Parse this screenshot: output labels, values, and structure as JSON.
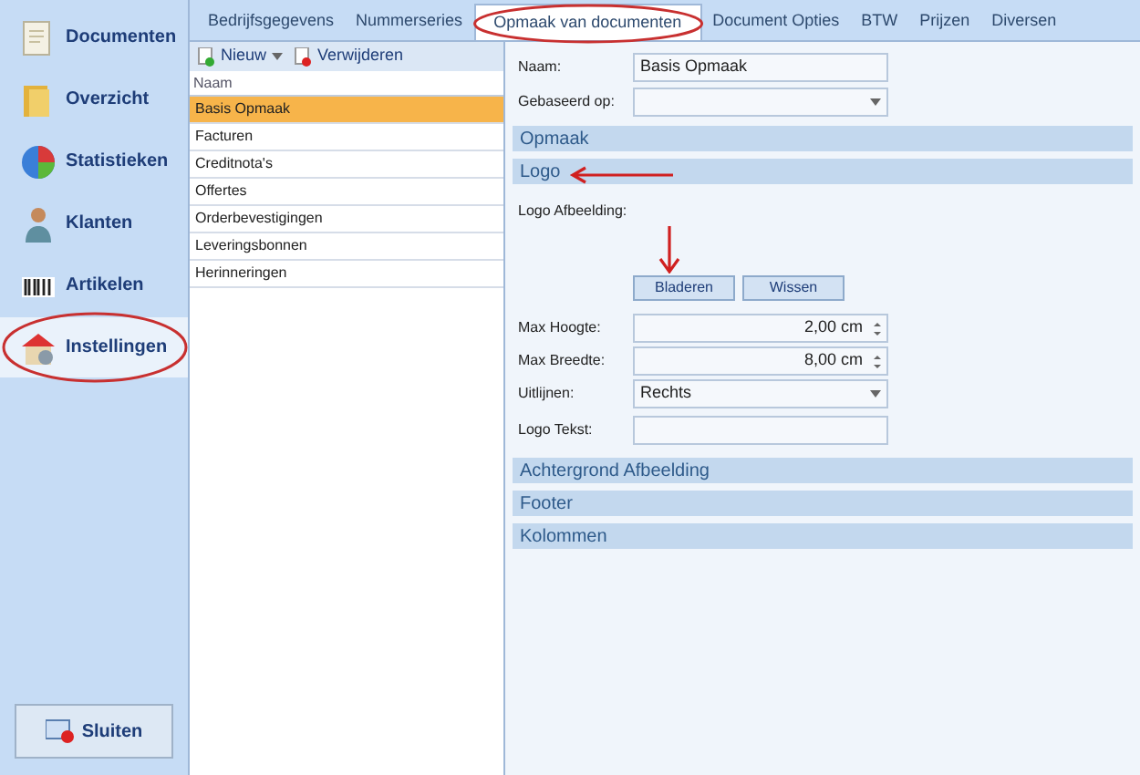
{
  "sidebar": {
    "items": [
      {
        "label": "Documenten",
        "kind": "document",
        "selected": false
      },
      {
        "label": "Overzicht",
        "kind": "folder",
        "selected": false
      },
      {
        "label": "Statistieken",
        "kind": "chart",
        "selected": false
      },
      {
        "label": "Klanten",
        "kind": "person",
        "selected": false
      },
      {
        "label": "Artikelen",
        "kind": "barcode",
        "selected": false
      },
      {
        "label": "Instellingen",
        "kind": "house",
        "selected": true
      }
    ],
    "close_button": "Sluiten"
  },
  "tabs": [
    {
      "label": "Bedrijfsgegevens",
      "selected": false
    },
    {
      "label": "Nummerseries",
      "selected": false
    },
    {
      "label": "Opmaak van documenten",
      "selected": true
    },
    {
      "label": "Document Opties",
      "selected": false
    },
    {
      "label": "BTW",
      "selected": false
    },
    {
      "label": "Prijzen",
      "selected": false
    },
    {
      "label": "Diversen",
      "selected": false
    }
  ],
  "toolbar": {
    "new": "Nieuw",
    "delete": "Verwijderen"
  },
  "list": {
    "column": "Naam",
    "rows": [
      {
        "label": "Basis Opmaak",
        "selected": true
      },
      {
        "label": "Facturen",
        "selected": false
      },
      {
        "label": "Creditnota's",
        "selected": false
      },
      {
        "label": "Offertes",
        "selected": false
      },
      {
        "label": "Orderbevestigingen",
        "selected": false
      },
      {
        "label": "Leveringsbonnen",
        "selected": false
      },
      {
        "label": "Herinneringen",
        "selected": false
      }
    ]
  },
  "form": {
    "top_fields": [
      {
        "kind": "text",
        "label": "Naam:",
        "value": "Basis Opmaak"
      },
      {
        "kind": "select",
        "label": "Gebaseerd op:"
      }
    ],
    "sections_before": [
      "Opmaak"
    ],
    "logo_section": {
      "title": "Logo",
      "image_label": "Logo Afbeelding:",
      "buttons": [
        "Bladeren",
        "Wissen"
      ],
      "fields": [
        {
          "kind": "spin",
          "label": "Max Hoogte:",
          "value": "2,00 cm"
        },
        {
          "kind": "spin",
          "label": "Max Breedte:",
          "value": "8,00 cm"
        },
        {
          "kind": "select",
          "label": "Uitlijnen:",
          "value": "Rechts"
        },
        {
          "kind": "text",
          "label": "Logo Tekst:"
        }
      ]
    },
    "sections_after": [
      "Achtergrond Afbeelding",
      "Footer",
      "Kolommen"
    ]
  }
}
